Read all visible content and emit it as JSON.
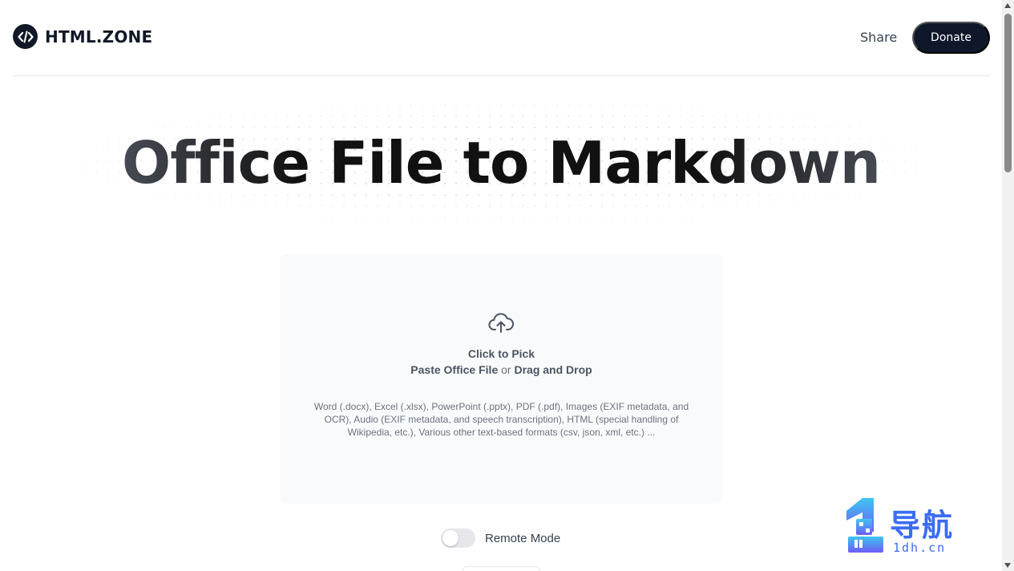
{
  "header": {
    "logo_text": "HTML.ZONE",
    "share_label": "Share",
    "donate_label": "Donate"
  },
  "hero": {
    "title": "Office File to Markdown"
  },
  "dropzone": {
    "icon": "cloud-upload-icon",
    "click_label": "Click to Pick",
    "paste_label": "Paste Office File",
    "or_label": "or",
    "drag_label": "Drag and Drop",
    "formats": "Word (.docx), Excel (.xlsx), PowerPoint (.pptx), PDF (.pdf), Images (EXIF metadata, and OCR), Audio (EXIF metadata, and speech transcription), HTML (special handling of Wikipedia, etc.), Various other text-based formats (csv, json, xml, etc.) ..."
  },
  "options": {
    "remote_mode_label": "Remote Mode",
    "remote_mode_enabled": false
  },
  "watermark": {
    "title": "导航",
    "domain": "1dh.cn"
  },
  "colors": {
    "primary_dark": "#0f172a",
    "dropzone_bg": "#f9fafb",
    "watermark_blue": "#3b6cf6"
  }
}
